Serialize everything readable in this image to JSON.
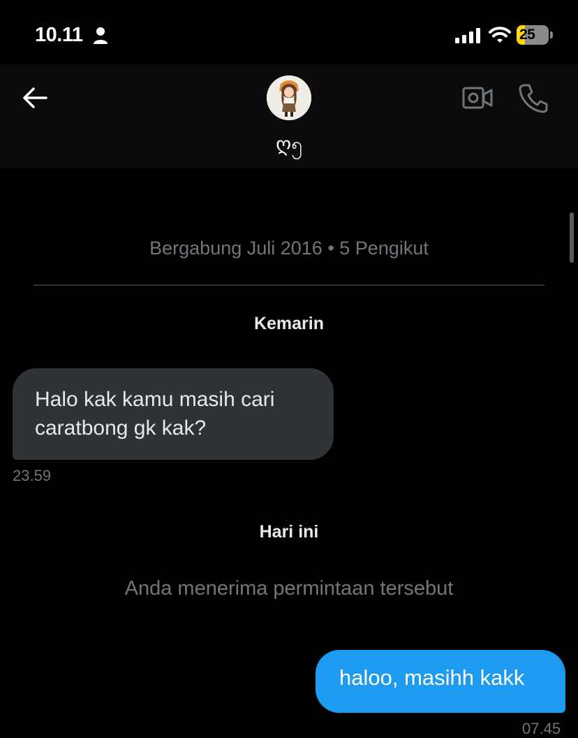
{
  "status_bar": {
    "time": "10.11",
    "battery": "25",
    "battery_level_percent": 25,
    "icons": [
      "person-icon",
      "signal-icon",
      "wifi-icon",
      "battery-icon"
    ]
  },
  "header": {
    "username": "ღ၅",
    "icons": [
      "back-arrow-icon",
      "video-call-icon",
      "phone-call-icon"
    ]
  },
  "conversation": {
    "joined_info": "Bergabung Juli 2016 • 5 Pengikut",
    "day1_label": "Kemarin",
    "incoming": {
      "text": "Halo kak kamu masih cari caratbong gk kak?",
      "time": "23.59"
    },
    "day2_label": "Hari ini",
    "system_notice": "Anda menerima permintaan tersebut",
    "outgoing": {
      "text": "haloo, masihh kakk",
      "time": "07.45"
    }
  },
  "colors": {
    "background": "#000000",
    "header_bg": "#0b0b0b",
    "incoming_bubble": "#2f3336",
    "outgoing_bubble": "#1d9bf0",
    "muted_text": "#71767b",
    "battery_accent": "#ffd60a"
  }
}
